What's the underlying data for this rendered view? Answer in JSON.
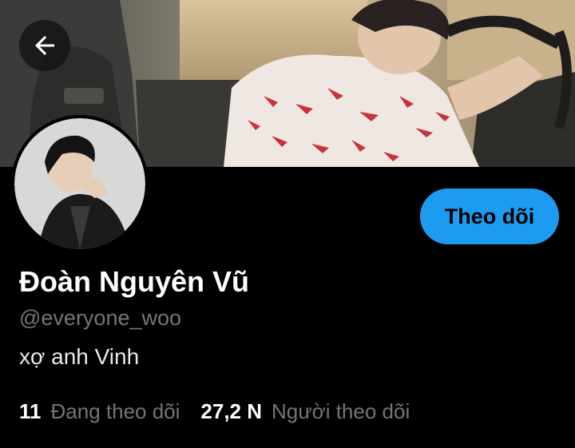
{
  "header": {
    "back_icon": "arrow-left-icon"
  },
  "profile": {
    "display_name": "Đoàn Nguyên Vũ",
    "handle": "@everyone_woo",
    "bio": "xợ anh Vinh",
    "follow_button": "Theo dõi",
    "stats": {
      "following_count": "11",
      "following_label": "Đang theo dõi",
      "followers_count": "27,2 N",
      "followers_label": "Người theo dõi"
    }
  },
  "colors": {
    "accent": "#1d9bf0",
    "background": "#000000",
    "secondary_text": "#71767b"
  }
}
